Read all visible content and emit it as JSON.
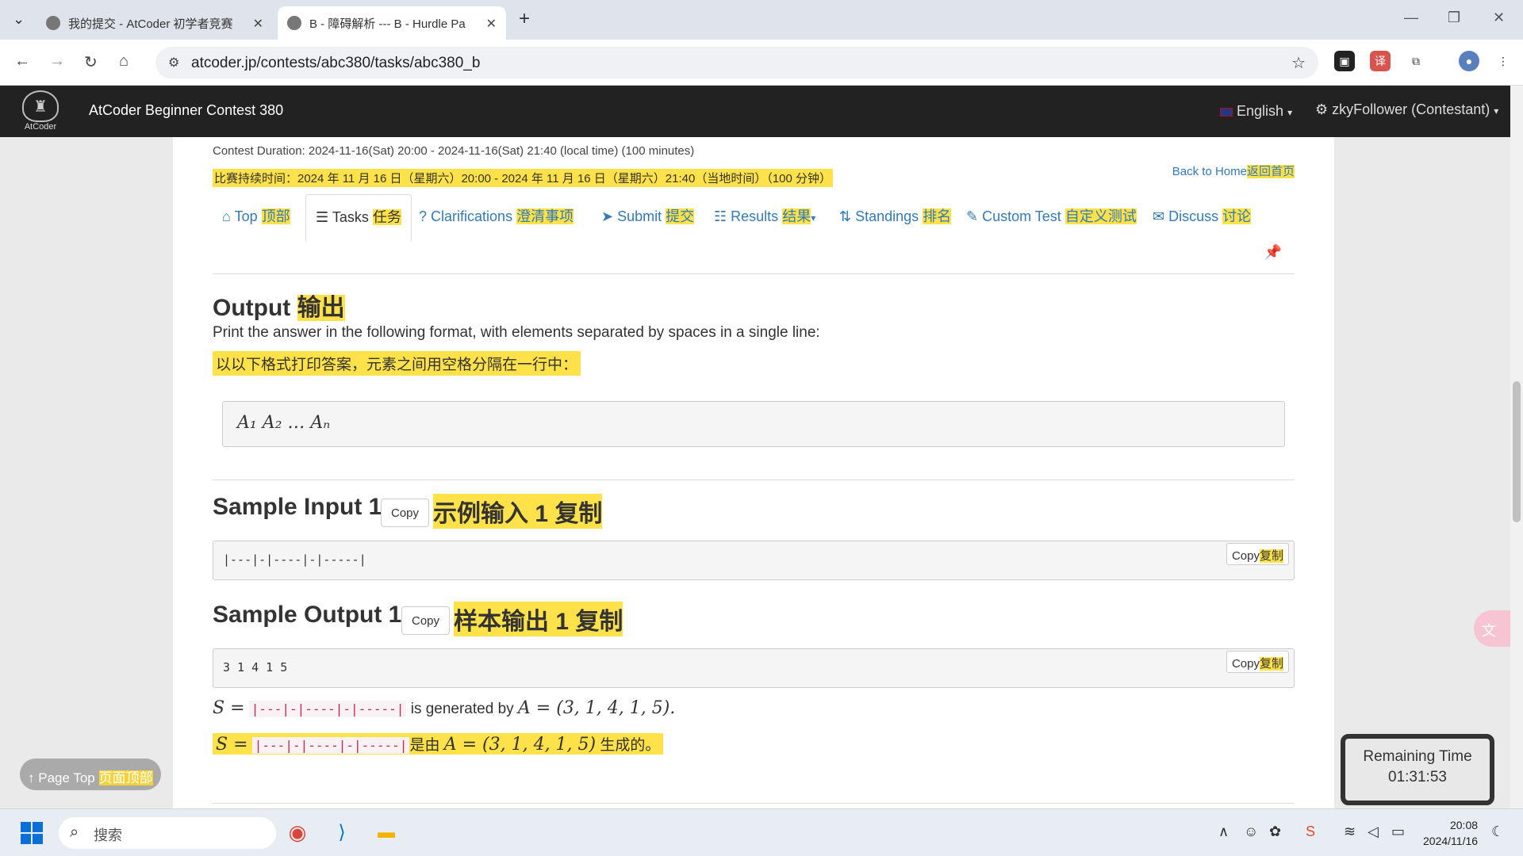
{
  "browser": {
    "tabs": [
      {
        "title": "我的提交 - AtCoder 初学者竞赛",
        "active": false
      },
      {
        "title": "B - 障碍解析 --- B - Hurdle Pa",
        "active": true
      }
    ],
    "url": "atcoder.jp/contests/abc380/tasks/abc380_b"
  },
  "navbar": {
    "logo_text": "AtCoder",
    "contest_name": "AtCoder Beginner Contest 380",
    "language": "English",
    "user": "zkyFollower (Contestant)"
  },
  "header": {
    "duration_en": "Contest Duration: 2024-11-16(Sat) 20:00 - 2024-11-16(Sat) 21:40 (local time) (100 minutes)",
    "duration_zh": "比赛持续时间：2024 年 11 月 16 日（星期六）20:00 - 2024 年 11 月 16 日（星期六）21:40（当地时间）（100 分钟）",
    "back_en": "Back to Home",
    "back_zh": "返回首页"
  },
  "menu": [
    {
      "en": "Top",
      "zh": "顶部"
    },
    {
      "en": "Tasks",
      "zh": "任务"
    },
    {
      "en": "Clarifications",
      "zh": "澄清事项"
    },
    {
      "en": "Submit",
      "zh": "提交"
    },
    {
      "en": "Results",
      "zh": "结果"
    },
    {
      "en": "Standings",
      "zh": "排名"
    },
    {
      "en": "Custom Test",
      "zh": "自定义测试"
    },
    {
      "en": "Discuss",
      "zh": "讨论"
    }
  ],
  "output_section": {
    "title_en": "Output",
    "title_zh": "输出",
    "desc_en": "Print the answer in the following format, with elements separated by spaces in a single line:",
    "desc_zh": "以以下格式打印答案，元素之间用空格分隔在一行中：",
    "format": "A₁   A₂   …   Aₙ"
  },
  "sample_input": {
    "title_en": "Sample Input 1",
    "copy": "Copy",
    "title_zh": "示例输入 1 复制",
    "content": "|---|-|----|-|-----|",
    "pre_copy_en": "Copy",
    "pre_copy_zh": "复制"
  },
  "sample_output": {
    "title_en": "Sample Output 1",
    "copy": "Copy",
    "title_zh": "样本输出 1 复制",
    "content": "3 1 4 1 5",
    "pre_copy_en": "Copy",
    "pre_copy_zh": "复制",
    "expl_s": "S =",
    "expl_code": "|---|-|----|-|-----|",
    "expl_mid_en": " is generated by ",
    "expl_a": "A = (3, 1, 4, 1, 5).",
    "expl_mid_zh": "是由 ",
    "expl_a_zh": "A = (3, 1, 4, 1, 5)",
    "expl_end_zh": " 生成的。"
  },
  "page_top": {
    "en": "Page Top",
    "zh": "页面顶部"
  },
  "remaining": {
    "label": "Remaining Time",
    "value": "01:31:53"
  },
  "taskbar": {
    "search_placeholder": "搜索",
    "time": "20:08",
    "date": "2024/11/16"
  }
}
